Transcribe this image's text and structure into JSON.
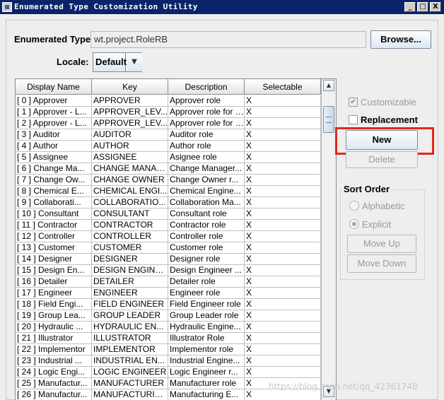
{
  "window": {
    "title": "Enumerated Type Customization Utility",
    "minimize_glyph": "_",
    "maximize_glyph": "□",
    "close_glyph": "X"
  },
  "form": {
    "type_label": "Enumerated Type:",
    "type_value": "wt.project.RoleRB",
    "browse_label": "Browse...",
    "locale_label": "Locale:",
    "locale_value": "Default",
    "locale_arrow": "▼"
  },
  "table": {
    "columns": [
      "Display Name",
      "Key",
      "Description",
      "Selectable"
    ],
    "rows": [
      [
        "[ 0 ]  Approver",
        "APPROVER",
        "Approver role",
        "X"
      ],
      [
        "[ 1 ]  Approver - L...",
        "APPROVER_LEV...",
        "Approver role for l...",
        "X"
      ],
      [
        "[ 2 ]  Approver - L...",
        "APPROVER_LEV...",
        "Approver role for l...",
        "X"
      ],
      [
        "[ 3 ]  Auditor",
        "AUDITOR",
        "Auditor role",
        "X"
      ],
      [
        "[ 4 ]  Author",
        "AUTHOR",
        "Author role",
        "X"
      ],
      [
        "[ 5 ]  Assignee",
        "ASSIGNEE",
        "Asignee role",
        "X"
      ],
      [
        "[ 6 ]  Change Ma...",
        "CHANGE MANAG...",
        "Change Manager...",
        "X"
      ],
      [
        "[ 7 ]  Change Ow...",
        "CHANGE OWNER",
        "Change Owner r...",
        "X"
      ],
      [
        "[ 8 ]  Chemical E...",
        "CHEMICAL ENGI...",
        "Chemical Engine...",
        "X"
      ],
      [
        "[ 9 ]  Collaborati...",
        "COLLABORATIO...",
        "Collaboration Ma...",
        "X"
      ],
      [
        "[ 10 ]  Consultant",
        "CONSULTANT",
        "Consultant role",
        "X"
      ],
      [
        "[ 11 ]  Contractor",
        "CONTRACTOR",
        "Contractor role",
        "X"
      ],
      [
        "[ 12 ]  Controller",
        "CONTROLLER",
        "Controller role",
        "X"
      ],
      [
        "[ 13 ]  Customer",
        "CUSTOMER",
        "Customer role",
        "X"
      ],
      [
        "[ 14 ]  Designer",
        "DESIGNER",
        "Designer role",
        "X"
      ],
      [
        "[ 15 ]  Design En...",
        "DESIGN ENGINE...",
        "Design Engineer ...",
        "X"
      ],
      [
        "[ 16 ]  Detailer",
        "DETAILER",
        "Detailer role",
        "X"
      ],
      [
        "[ 17 ]  Engineer",
        "ENGINEER",
        "Engineer role",
        "X"
      ],
      [
        "[ 18 ]  Field Engi...",
        "FIELD ENGINEER",
        "Field Engineer role",
        "X"
      ],
      [
        "[ 19 ]  Group Lea...",
        "GROUP LEADER",
        "Group Leader role",
        "X"
      ],
      [
        "[ 20 ]  Hydraulic ...",
        "HYDRAULIC EN...",
        "Hydraulic Engine...",
        "X"
      ],
      [
        "[ 21 ]  Illustrator",
        "ILLUSTRATOR",
        "Illustrator Role",
        "X"
      ],
      [
        "[ 22 ]  Implementor",
        "IMPLEMENTOR",
        "Implementor role",
        "X"
      ],
      [
        "[ 23 ]  Industrial ...",
        "INDUSTRIAL EN...",
        "Industrial Engine...",
        "X"
      ],
      [
        "[ 24 ]  Logic Engi...",
        "LOGIC ENGINEER",
        "Logic Engineer r...",
        "X"
      ],
      [
        "[ 25 ]  Manufactur...",
        "MANUFACTURER",
        "Manufacturer role",
        "X"
      ],
      [
        "[ 26 ]  Manufactur...",
        "MANUFACTURIN...",
        "Manufacturing E...",
        "X"
      ]
    ],
    "scroll_up": "▲",
    "scroll_down": "▼"
  },
  "side": {
    "customizable_label": "Customizable",
    "customizable_mark": "✔",
    "replacement_label": "Replacement",
    "new_label": "New",
    "delete_label": "Delete",
    "sort_order_label": "Sort Order",
    "alphabetic_label": "Alphabetic",
    "explicit_label": "Explicit",
    "move_up_label": "Move Up",
    "move_down_label": "Move Down"
  },
  "watermark": "https://blog.csdn.net/qq_42361748"
}
